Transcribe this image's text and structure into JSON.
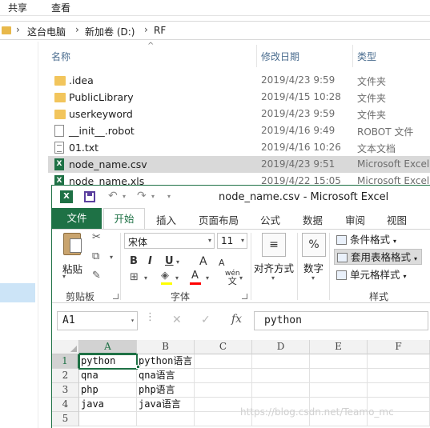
{
  "explorer": {
    "ribbon_tabs": [
      "共享",
      "查看"
    ],
    "breadcrumb": [
      "这台电脑",
      "新加卷 (D:)",
      "RF"
    ],
    "columns": {
      "name": "名称",
      "date": "修改日期",
      "type": "类型"
    },
    "files": [
      {
        "name": ".idea",
        "date": "2019/4/23 9:59",
        "type": "文件夹",
        "icon": "folder-icon"
      },
      {
        "name": "PublicLibrary",
        "date": "2019/4/15 10:28",
        "type": "文件夹",
        "icon": "folder-icon"
      },
      {
        "name": "userkeyword",
        "date": "2019/4/23 9:59",
        "type": "文件夹",
        "icon": "folder-icon"
      },
      {
        "name": "__init__.robot",
        "date": "2019/4/16 9:49",
        "type": "ROBOT 文件",
        "icon": "file-icon"
      },
      {
        "name": "01.txt",
        "date": "2019/4/16 10:26",
        "type": "文本文档",
        "icon": "text-file-icon"
      },
      {
        "name": "node_name.csv",
        "date": "2019/4/23 9:51",
        "type": "Microsoft Excel",
        "icon": "excel-file-icon",
        "selected": true
      },
      {
        "name": "node_name.xls",
        "date": "2019/4/22 15:05",
        "type": "Microsoft Excel",
        "icon": "excel-file-icon"
      }
    ]
  },
  "excel": {
    "window_title": "node_name.csv - Microsoft Excel",
    "logo_letter": "X",
    "tabs": {
      "file": "文件",
      "home": "开始",
      "insert": "插入",
      "page_layout": "页面布局",
      "formulas": "公式",
      "data": "数据",
      "review": "审阅",
      "view": "视图"
    },
    "clipboard": {
      "paste": "粘贴",
      "group": "剪贴板"
    },
    "font": {
      "name": "宋体",
      "size": "11",
      "bold": "B",
      "italic": "I",
      "underline": "U",
      "grow": "A",
      "shrink": "A",
      "font_color": "A",
      "wen": "wén",
      "wen_char": "文",
      "group": "字体"
    },
    "alignment": {
      "label": "对齐方式"
    },
    "number": {
      "label": "数字",
      "symbol": "%"
    },
    "styles": {
      "conditional": "条件格式",
      "table": "套用表格格式",
      "cell": "单元格样式",
      "group": "样式"
    },
    "formula_bar": {
      "cell_ref": "A1",
      "fx": "fx",
      "content": "python"
    },
    "grid": {
      "columns": [
        "A",
        "B",
        "C",
        "D",
        "E",
        "F"
      ],
      "rows": [
        "1",
        "2",
        "3",
        "4",
        "5"
      ],
      "cells": [
        [
          "python",
          "python语言"
        ],
        [
          "qna",
          "qna语言"
        ],
        [
          "php",
          "php语言"
        ],
        [
          "java",
          "java语言"
        ],
        [
          "",
          ""
        ]
      ]
    },
    "accent_color": "#1e7145"
  },
  "watermark": "https://blog.csdn.net/Teamo_mc"
}
